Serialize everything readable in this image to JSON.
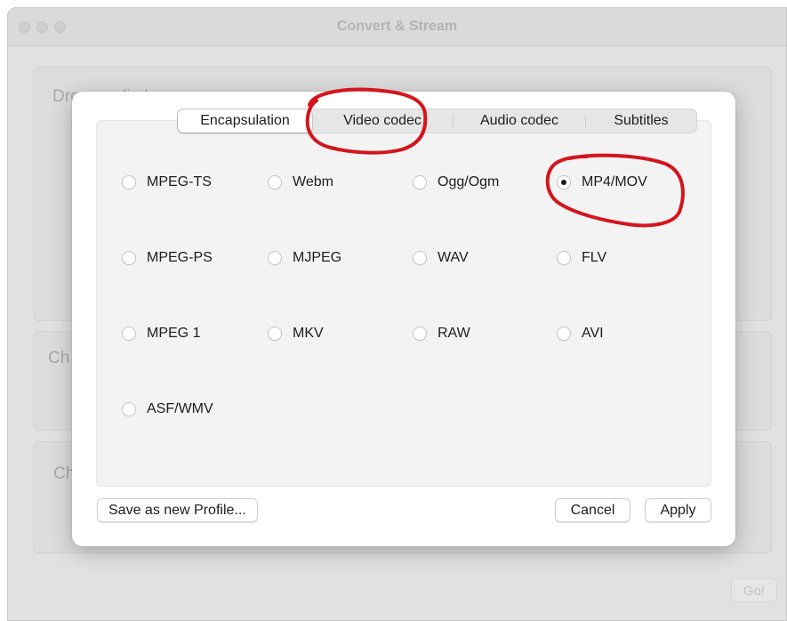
{
  "window": {
    "title": "Convert & Stream",
    "background_labels": [
      "Drop media here",
      "Ch",
      "Ch"
    ],
    "go_label": "Go!"
  },
  "tabs": [
    {
      "label": "Encapsulation",
      "selected": true
    },
    {
      "label": "Video codec",
      "selected": false
    },
    {
      "label": "Audio codec",
      "selected": false
    },
    {
      "label": "Subtitles",
      "selected": false
    }
  ],
  "formats": [
    {
      "label": "MPEG-TS",
      "checked": false
    },
    {
      "label": "Webm",
      "checked": false
    },
    {
      "label": "Ogg/Ogm",
      "checked": false
    },
    {
      "label": "MP4/MOV",
      "checked": true
    },
    {
      "label": "MPEG-PS",
      "checked": false
    },
    {
      "label": "MJPEG",
      "checked": false
    },
    {
      "label": "WAV",
      "checked": false
    },
    {
      "label": "FLV",
      "checked": false
    },
    {
      "label": "MPEG 1",
      "checked": false
    },
    {
      "label": "MKV",
      "checked": false
    },
    {
      "label": "RAW",
      "checked": false
    },
    {
      "label": "AVI",
      "checked": false
    },
    {
      "label": "ASF/WMV",
      "checked": false
    }
  ],
  "buttons": {
    "save_profile": "Save as new Profile...",
    "cancel": "Cancel",
    "apply": "Apply"
  },
  "annotation_color": "#d4151d"
}
